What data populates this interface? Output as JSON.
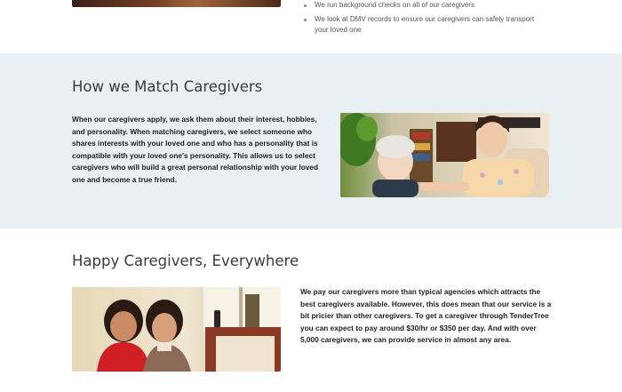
{
  "top": {
    "bullets": [
      "We run background checks on all of our caregivers",
      "We look at DMV records to ensure our caregivers can safely transport your loved one"
    ]
  },
  "match": {
    "title": "How we Match Caregivers",
    "text": "When our caregivers apply, we ask them about their interest, hobbies, and personality. When matching caregivers, we select someone who shares interests with your loved one and who has a personality that is compatible with your loved one's personality. This allows us to select caregivers who will build a great personal relationship with your loved one and become a true friend."
  },
  "happy": {
    "title": "Happy Caregivers, Everywhere",
    "text": "We pay our caregivers more than typical agencies which attracts the best caregivers available. However, this does mean that our service is a bit pricier than other caregivers. To get a caregiver through TenderTree you can expect to pay around $30/hr or $350 per day. And with over 5,000 caregivers, we can provide service in almost any area."
  }
}
